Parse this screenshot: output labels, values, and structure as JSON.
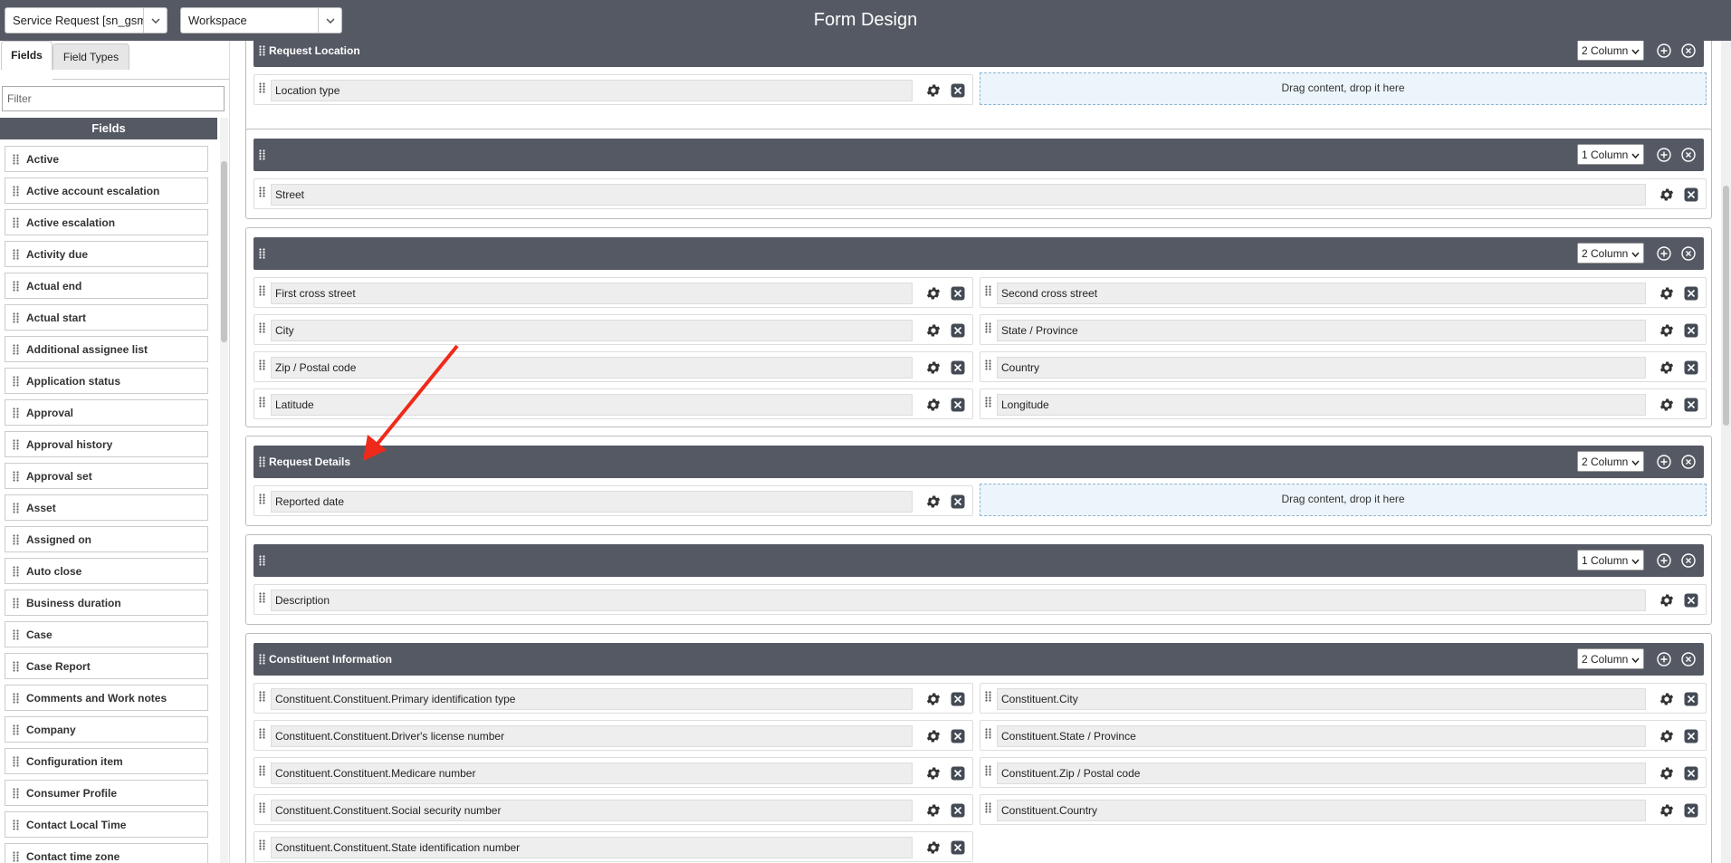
{
  "header": {
    "table_select": "Service Request [sn_gsm_",
    "view_select": "Workspace",
    "title": "Form Design"
  },
  "sidebar": {
    "tabs": [
      {
        "label": "Fields",
        "active": true
      },
      {
        "label": "Field Types",
        "active": false
      }
    ],
    "filter_placeholder": "Filter",
    "list_header": "Fields",
    "fields": [
      "Active",
      "Active account escalation",
      "Active escalation",
      "Activity due",
      "Actual end",
      "Actual start",
      "Additional assignee list",
      "Application status",
      "Approval",
      "Approval history",
      "Approval set",
      "Asset",
      "Assigned on",
      "Auto close",
      "Business duration",
      "Case",
      "Case Report",
      "Comments and Work notes",
      "Company",
      "Configuration item",
      "Consumer Profile",
      "Contact Local Time",
      "Contact time zone"
    ]
  },
  "sections": [
    {
      "title": "Request Location",
      "columns": "2 Column",
      "rows": [
        [
          "Location type",
          null
        ]
      ]
    },
    {
      "title": "",
      "columns": "1 Column",
      "rows": [
        [
          "Street"
        ]
      ]
    },
    {
      "title": "",
      "columns": "2 Column",
      "rows": [
        [
          "First cross street",
          "Second cross street"
        ],
        [
          "City",
          "State / Province"
        ],
        [
          "Zip / Postal code",
          "Country"
        ],
        [
          "Latitude",
          "Longitude"
        ]
      ]
    },
    {
      "title": "Request Details",
      "columns": "2 Column",
      "rows": [
        [
          "Reported date",
          null
        ]
      ]
    },
    {
      "title": "",
      "columns": "1 Column",
      "rows": [
        [
          "Description"
        ]
      ]
    },
    {
      "title": "Constituent Information",
      "columns": "2 Column",
      "rows": [
        [
          "Constituent.Constituent.Primary identification type",
          "Constituent.City"
        ],
        [
          "Constituent.Constituent.Driver's license number",
          "Constituent.State / Province"
        ],
        [
          "Constituent.Constituent.Medicare number",
          "Constituent.Zip / Postal code"
        ],
        [
          "Constituent.Constituent.Social security number",
          "Constituent.Country"
        ],
        [
          "Constituent.Constituent.State identification number",
          ""
        ]
      ]
    }
  ],
  "drop_placeholder": "Drag content, drop it here",
  "colors": {
    "header_bg": "#555963",
    "annotation_arrow": "#f02a1a"
  }
}
